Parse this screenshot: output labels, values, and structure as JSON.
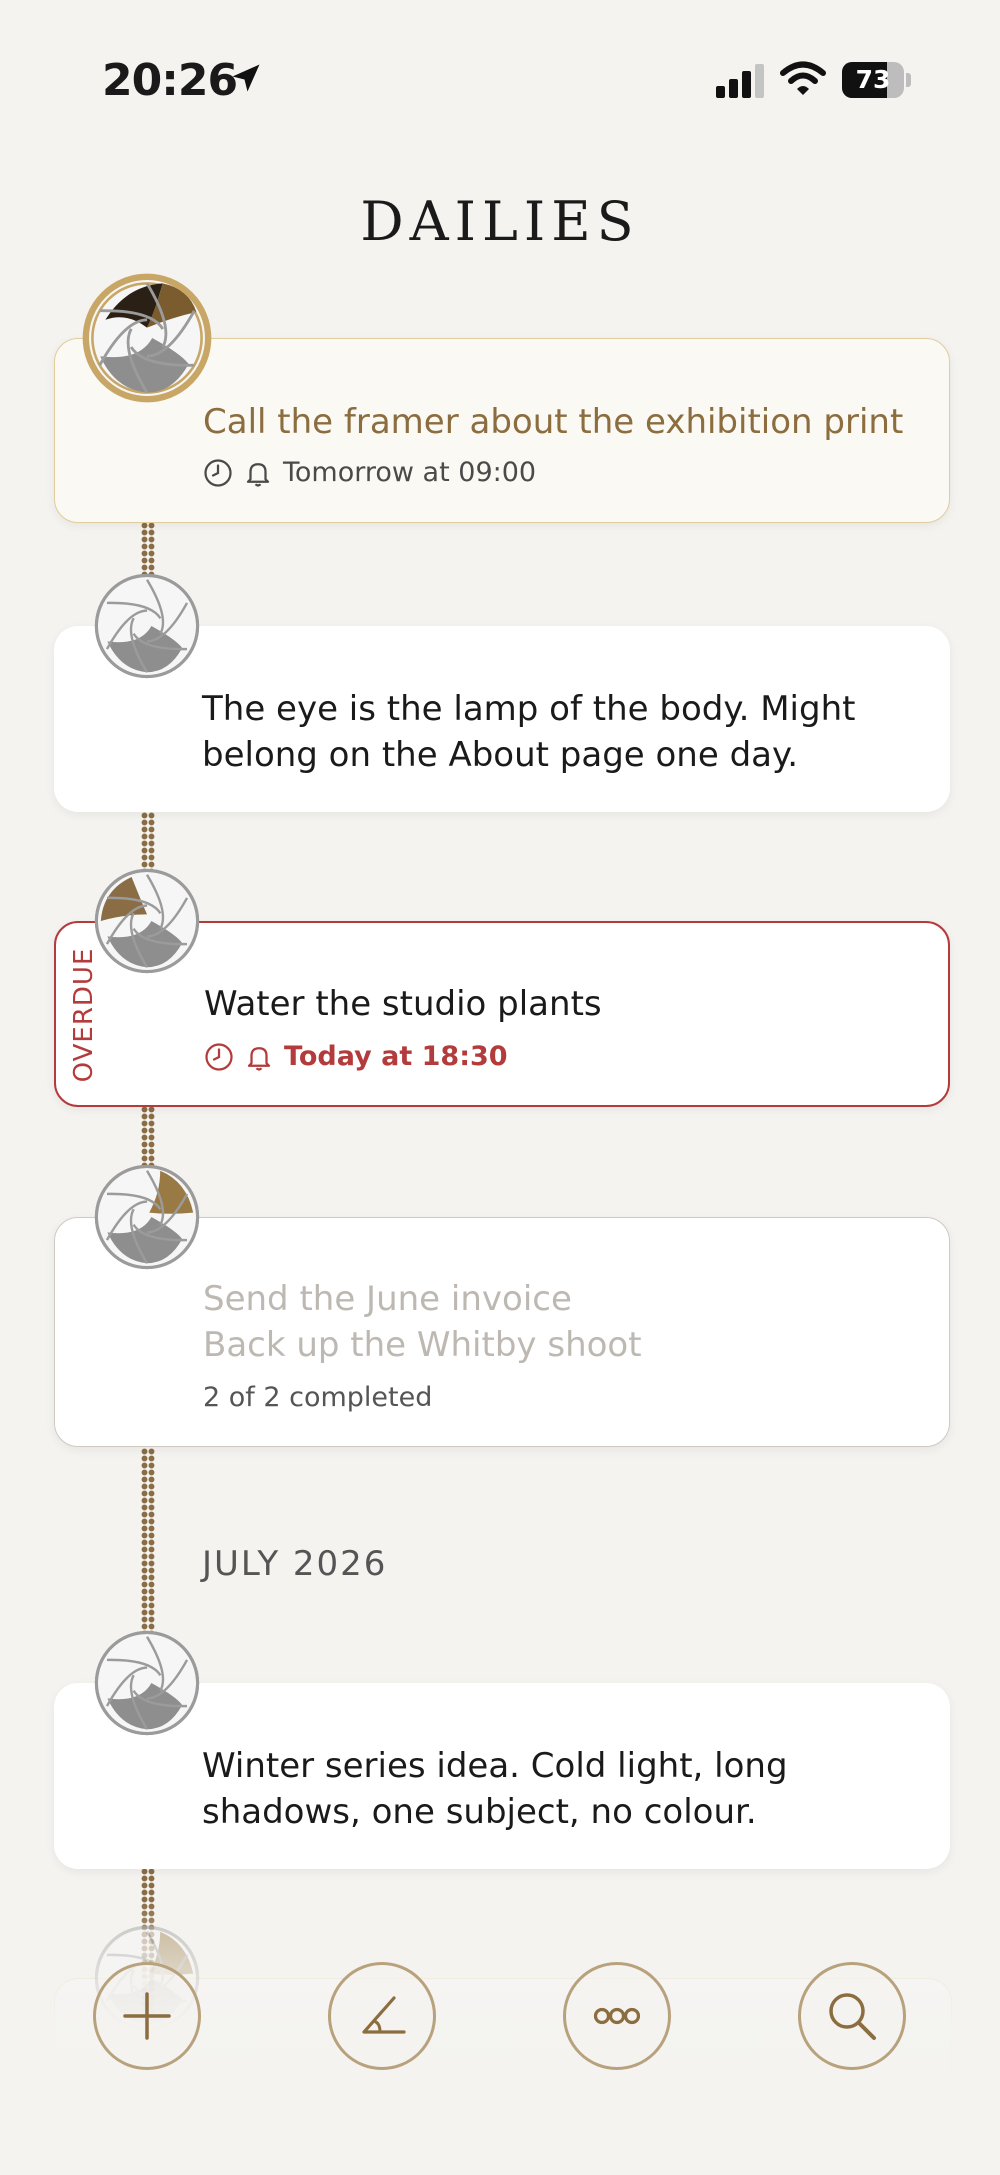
{
  "status_bar": {
    "time": "20:26",
    "battery": "73",
    "battery_level": 0.73,
    "icons": [
      "location-arrow-icon",
      "cellular-signal-icon",
      "wifi-icon",
      "battery-icon"
    ]
  },
  "header": {
    "title": "DAILIES"
  },
  "entries": [
    {
      "type": "reminder",
      "text": "Call the framer about the exhibition print",
      "meta": "Tomorrow at 09:00"
    },
    {
      "type": "note",
      "text": "The eye is the lamp of the body. Might belong on the About page one day."
    },
    {
      "type": "overdue",
      "badge": "OVERDUE",
      "text": "Water the studio plants",
      "meta": "Today at 18:30"
    },
    {
      "type": "completed",
      "items": [
        "Send the June invoice",
        "Back up the Whitby shoot"
      ],
      "meta": "2 of 2 completed"
    },
    {
      "type": "note",
      "text": "Winter series idea. Cold light, long shadows, one subject, no colour."
    }
  ],
  "section": {
    "label": "JULY 2026"
  },
  "colors": {
    "background": "#f4f3f0",
    "accent_gold": "#8b6d3f",
    "overdue_red": "#b33b3b",
    "completed_gray": "#bdb8b1"
  },
  "toolbar": {
    "buttons": [
      {
        "icon": "plus-icon"
      },
      {
        "icon": "angle-icon"
      },
      {
        "icon": "more-dots-icon"
      },
      {
        "icon": "search-icon"
      }
    ]
  }
}
